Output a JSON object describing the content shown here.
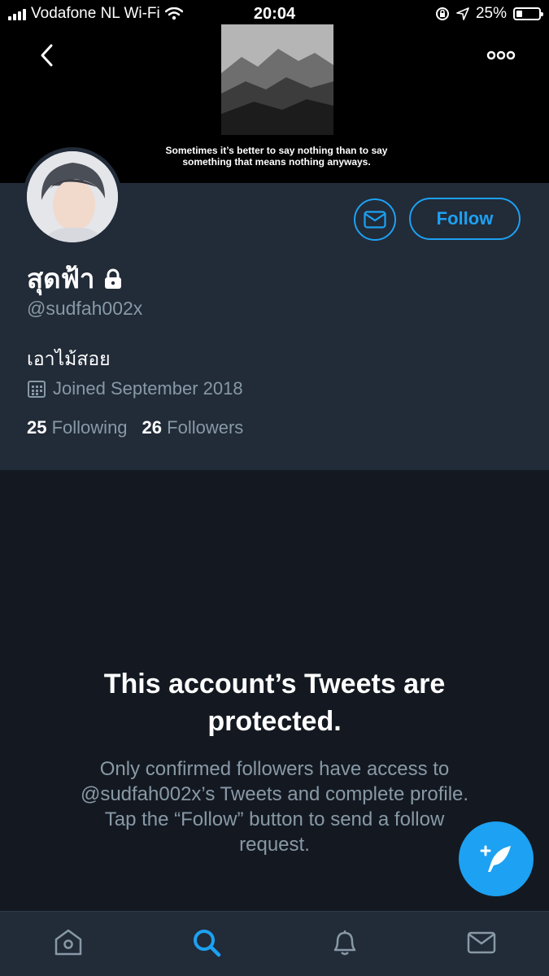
{
  "status_bar": {
    "carrier": "Vodafone NL Wi-Fi",
    "time": "20:04",
    "battery": "25%",
    "battery_level": 0.25
  },
  "banner": {
    "quote_line1": "Sometimes it’s better to say nothing than to say",
    "quote_line2": "something that means nothing anyways."
  },
  "profile": {
    "display_name": "สุดฟ้า",
    "handle": "@sudfah002x",
    "bio": "เอาไม้สอย",
    "joined": "Joined September 2018",
    "following_count": "25",
    "following_label": "Following",
    "followers_count": "26",
    "followers_label": "Followers",
    "follow_label": "Follow"
  },
  "protected": {
    "title_line1": "This account’s Tweets are",
    "title_line2": "protected.",
    "body_line1": "Only confirmed followers have access to",
    "body_line2": "@sudfah002x’s Tweets and complete profile.",
    "body_line3": "Tap the “Follow” button to send a follow",
    "body_line4": "request."
  },
  "tabs": [
    "home-icon",
    "search-icon",
    "notifications-icon",
    "messages-icon"
  ],
  "colors": {
    "accent": "#1da1f2",
    "background": "#141921",
    "header": "#222b38",
    "secondary_text": "#8899a6"
  }
}
